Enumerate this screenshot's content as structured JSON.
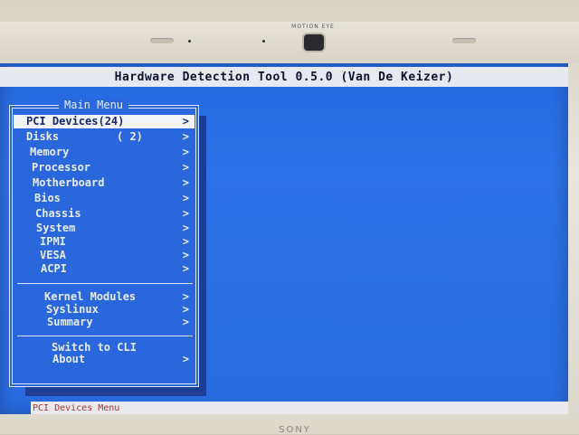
{
  "bezel": {
    "camera_label": "MOTION EYE",
    "brand": "SONY"
  },
  "title_bar": {
    "title": "Hardware Detection Tool 0.5.0 (Van De Keizer)"
  },
  "main_menu": {
    "title": "Main Menu",
    "selected_index": 0,
    "items": [
      {
        "label": "PCI Devices(24)",
        "count": "",
        "arrow": ">"
      },
      {
        "label": "Disks",
        "count": "( 2)",
        "arrow": ">"
      },
      {
        "label": "Memory",
        "count": "",
        "arrow": ">"
      },
      {
        "label": "Processor",
        "count": "",
        "arrow": ">"
      },
      {
        "label": "Motherboard",
        "count": "",
        "arrow": ">"
      },
      {
        "label": "Bios",
        "count": "",
        "arrow": ">"
      },
      {
        "label": "Chassis",
        "count": "",
        "arrow": ">"
      },
      {
        "label": "System",
        "count": "",
        "arrow": ">"
      },
      {
        "label": "IPMI",
        "count": "",
        "arrow": ">"
      },
      {
        "label": "VESA",
        "count": "",
        "arrow": ">"
      },
      {
        "label": "ACPI",
        "count": "",
        "arrow": ">"
      }
    ],
    "group2": [
      {
        "label": "Kernel Modules",
        "arrow": ">"
      },
      {
        "label": "Syslinux",
        "arrow": ">"
      },
      {
        "label": "Summary",
        "arrow": ">"
      }
    ],
    "group3": [
      {
        "label": "Switch to CLI",
        "arrow": ""
      },
      {
        "label": "About",
        "arrow": ">"
      }
    ]
  },
  "status_bar": {
    "text": "PCI Devices Menu"
  },
  "colors": {
    "screen_bg": "#2a6be0",
    "title_bg": "#e6eaf0",
    "status_text": "#b03030",
    "selected_bg": "#f2f4f8"
  }
}
